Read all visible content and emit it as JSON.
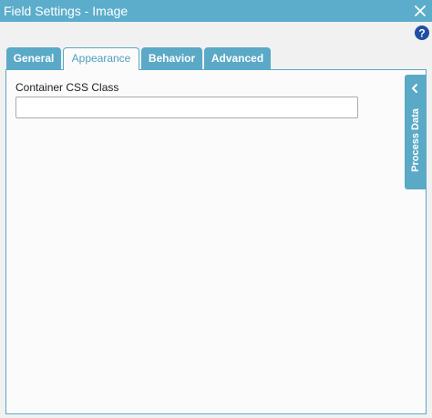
{
  "window": {
    "title": "Field Settings - Image",
    "close_icon": "close-icon",
    "help_icon": "help-icon"
  },
  "tabs": [
    {
      "label": "General",
      "active": false
    },
    {
      "label": "Appearance",
      "active": true
    },
    {
      "label": "Behavior",
      "active": false
    },
    {
      "label": "Advanced",
      "active": false
    }
  ],
  "appearance": {
    "container_css_class": {
      "label": "Container CSS Class",
      "value": "",
      "placeholder": ""
    }
  },
  "side_panel": {
    "label": "Process Data",
    "icon": "chevron-left-icon"
  },
  "colors": {
    "accent": "#5aa9c6",
    "title_bar": "#5badcb",
    "help_icon": "#1f4fa0",
    "panel_bg": "#fbfbfb"
  }
}
